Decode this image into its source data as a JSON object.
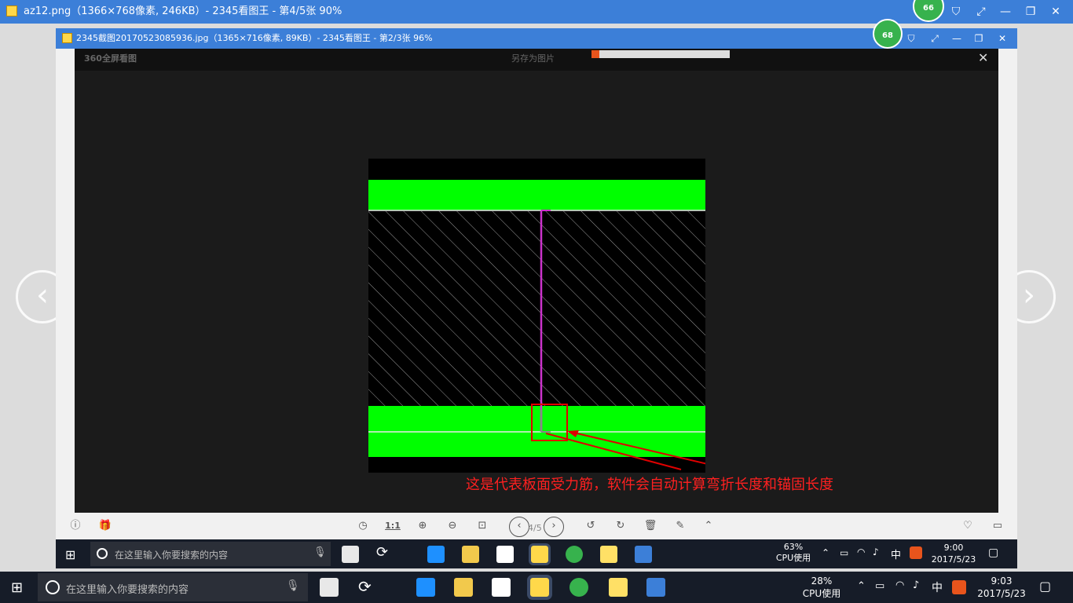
{
  "outer_window": {
    "title": "az12.png（1366×768像素, 246KB）- 2345看图王 - 第4/5张 90%",
    "badge": "66"
  },
  "inner_window": {
    "title": "2345截图20170523085936.jpg（1365×716像素, 89KB）- 2345看图王 - 第2/3张 96%",
    "badge": "68"
  },
  "viewer_header": {
    "brand": "360全屏看图",
    "save_label": "另存为图片"
  },
  "annotation": "这是代表板面受力筋，软件会自动计算弯折长度和锚固长度",
  "page_indicator": "4/5",
  "toolbar": {
    "ratio_label": "1:1"
  },
  "inner_taskbar": {
    "search_placeholder": "在这里输入你要搜索的内容",
    "cpu_percent": "63%",
    "cpu_label": "CPU使用",
    "ime": "中",
    "time": "9:00",
    "date": "2017/5/23"
  },
  "outer_taskbar": {
    "search_placeholder": "在这里输入你要搜索的内容",
    "cpu_percent": "28%",
    "cpu_label": "CPU使用",
    "ime": "中",
    "time": "9:03",
    "date": "2017/5/23"
  },
  "colors": {
    "titlebar": "#3c7fd8",
    "slab_green": "#00ff00",
    "rebar_magenta": "#cc33cc",
    "annotation_red": "#ff2020"
  }
}
